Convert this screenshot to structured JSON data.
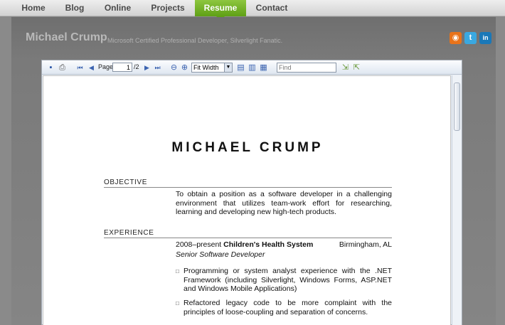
{
  "nav": {
    "items": [
      {
        "label": "Home"
      },
      {
        "label": "Blog"
      },
      {
        "label": "Online"
      },
      {
        "label": "Projects"
      },
      {
        "label": "Resume"
      },
      {
        "label": "Contact"
      }
    ],
    "active": "Resume"
  },
  "site": {
    "title": "Michael Crump",
    "tagline": "Microsoft Certified Professional Developer, Silverlight Fanatic."
  },
  "social": [
    {
      "icon": "rss-icon",
      "glyph": "◉",
      "color": "#e8731a"
    },
    {
      "icon": "twitter-icon",
      "glyph": "t",
      "color": "#3aa8e0"
    },
    {
      "icon": "linkedin-icon",
      "glyph": "in",
      "color": "#1a78b8"
    }
  ],
  "viewer": {
    "page_label": "Page",
    "page_value": "1",
    "page_total": "/2",
    "zoom_value": "Fit Width",
    "find_placeholder": "Find"
  },
  "resume": {
    "name": "MICHAEL CRUMP",
    "objective": {
      "heading": "OBJECTIVE",
      "text": "To obtain a position as a software developer in a challenging environment that utilizes team-work effort for researching, learning and developing new high-tech products."
    },
    "experience": {
      "heading": "EXPERIENCE",
      "jobs": [
        {
          "dates": "2008–present",
          "org": "Children's Health System",
          "location": "Birmingham, AL",
          "title": "Senior Software Developer",
          "bullets": [
            "Programming or system analyst experience with the .NET Framework (including Silverlight, Windows Forms, ASP.NET and Windows Mobile Applications)",
            "Refactored legacy code to be more complaint with the principles of loose-coupling and separation of concerns."
          ]
        }
      ]
    }
  },
  "colors": {
    "nav_active": "#6aad1d",
    "background": "#8a8a8a"
  }
}
